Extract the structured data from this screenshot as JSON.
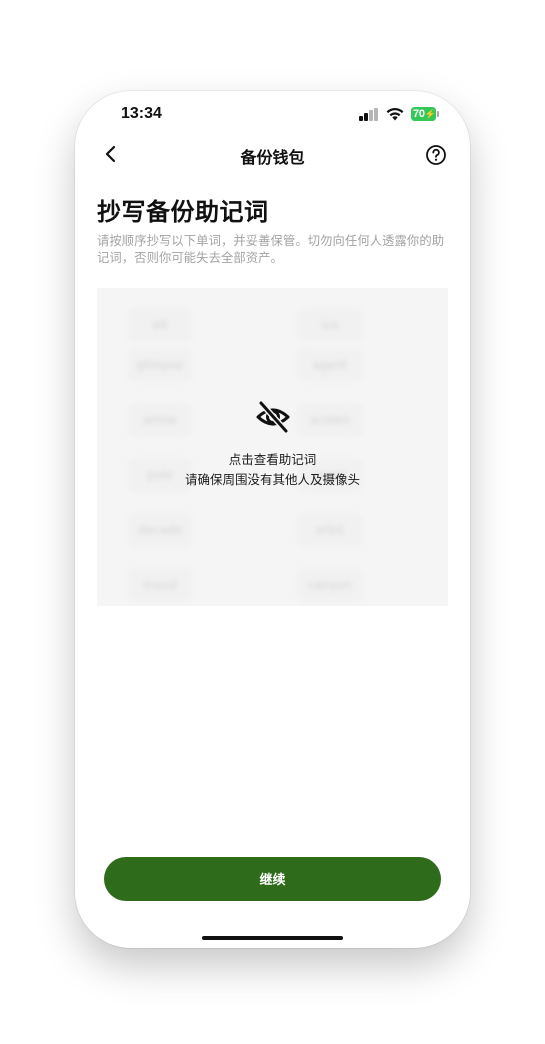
{
  "status_bar": {
    "time": "13:34",
    "battery_level": "70",
    "battery_color": "#34c759"
  },
  "nav": {
    "back_icon": "chevron-left-icon",
    "title": "备份钱包",
    "help_icon": "question-circle-icon"
  },
  "content": {
    "title": "抄写备份助记词",
    "description": "请按顺序抄写以下单词，并妥善保管。切勿向任何人透露你的助记词，否则你可能失去全部资产。"
  },
  "mnemonic": {
    "hidden": true,
    "words": [
      "alt",
      "ice",
      "glimpse",
      "agent",
      "arrow",
      "screen",
      "pole",
      "moon",
      "decade",
      "orbit",
      "mood",
      "canyon"
    ],
    "reveal_icon": "eye-off-icon",
    "reveal_title": "点击查看助记词",
    "reveal_hint": "请确保周围没有其他人及摄像头"
  },
  "actions": {
    "continue_label": "继续",
    "accent_color": "#2e6b1a"
  }
}
